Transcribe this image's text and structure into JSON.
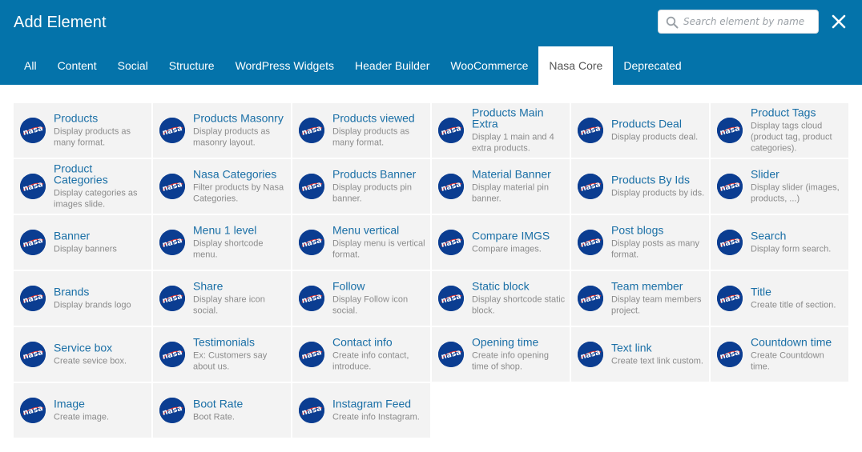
{
  "header": {
    "title": "Add Element",
    "search_placeholder": "Search element by name",
    "search_value": ""
  },
  "icons": {
    "search": "search-icon",
    "close": "close-icon",
    "element_logo": "nasa-logo-icon"
  },
  "colors": {
    "header_bg": "#0473aa",
    "card_bg": "#f3f3f3",
    "title_link": "#1a6fa6",
    "logo_bg": "#0b3d91"
  },
  "tabs": [
    {
      "label": "All",
      "active": false
    },
    {
      "label": "Content",
      "active": false
    },
    {
      "label": "Social",
      "active": false
    },
    {
      "label": "Structure",
      "active": false
    },
    {
      "label": "WordPress Widgets",
      "active": false
    },
    {
      "label": "Header Builder",
      "active": false
    },
    {
      "label": "WooCommerce",
      "active": false
    },
    {
      "label": "Nasa Core",
      "active": true
    },
    {
      "label": "Deprecated",
      "active": false
    }
  ],
  "logo_text": "nasa",
  "elements": [
    {
      "title": "Products",
      "desc": "Display products as many format."
    },
    {
      "title": "Products Masonry",
      "desc": "Display products as masonry layout."
    },
    {
      "title": "Products viewed",
      "desc": "Display products as many format."
    },
    {
      "title": "Products Main Extra",
      "desc": "Display 1 main and 4 extra products."
    },
    {
      "title": "Products Deal",
      "desc": "Display products deal."
    },
    {
      "title": "Product Tags",
      "desc": "Display tags cloud (product tag, product categories)."
    },
    {
      "title": "Product Categories",
      "desc": "Display categories as images slide."
    },
    {
      "title": "Nasa Categories",
      "desc": "Filter products by Nasa Categories."
    },
    {
      "title": "Products Banner",
      "desc": "Display products pin banner."
    },
    {
      "title": "Material Banner",
      "desc": "Display material pin banner."
    },
    {
      "title": "Products By Ids",
      "desc": "Display products by ids."
    },
    {
      "title": "Slider",
      "desc": "Display slider (images, products, ...)"
    },
    {
      "title": "Banner",
      "desc": "Display banners"
    },
    {
      "title": "Menu 1 level",
      "desc": "Display shortcode menu."
    },
    {
      "title": "Menu vertical",
      "desc": "Display menu is vertical format."
    },
    {
      "title": "Compare IMGS",
      "desc": "Compare images."
    },
    {
      "title": "Post blogs",
      "desc": "Display posts as many format."
    },
    {
      "title": "Search",
      "desc": "Display form search."
    },
    {
      "title": "Brands",
      "desc": "Display brands logo"
    },
    {
      "title": "Share",
      "desc": "Display share icon social."
    },
    {
      "title": "Follow",
      "desc": "Display Follow icon social."
    },
    {
      "title": "Static block",
      "desc": "Display shortcode static block."
    },
    {
      "title": "Team member",
      "desc": "Display team members project."
    },
    {
      "title": "Title",
      "desc": "Create title of section."
    },
    {
      "title": "Service box",
      "desc": "Create sevice box."
    },
    {
      "title": "Testimonials",
      "desc": "Ex: Customers say about us."
    },
    {
      "title": "Contact info",
      "desc": "Create info contact, introduce."
    },
    {
      "title": "Opening time",
      "desc": "Create info opening time of shop."
    },
    {
      "title": "Text link",
      "desc": "Create text link custom."
    },
    {
      "title": "Countdown time",
      "desc": "Create Countdown time."
    },
    {
      "title": "Image",
      "desc": "Create image."
    },
    {
      "title": "Boot Rate",
      "desc": "Boot Rate."
    },
    {
      "title": "Instagram Feed",
      "desc": "Create info Instagram."
    }
  ]
}
